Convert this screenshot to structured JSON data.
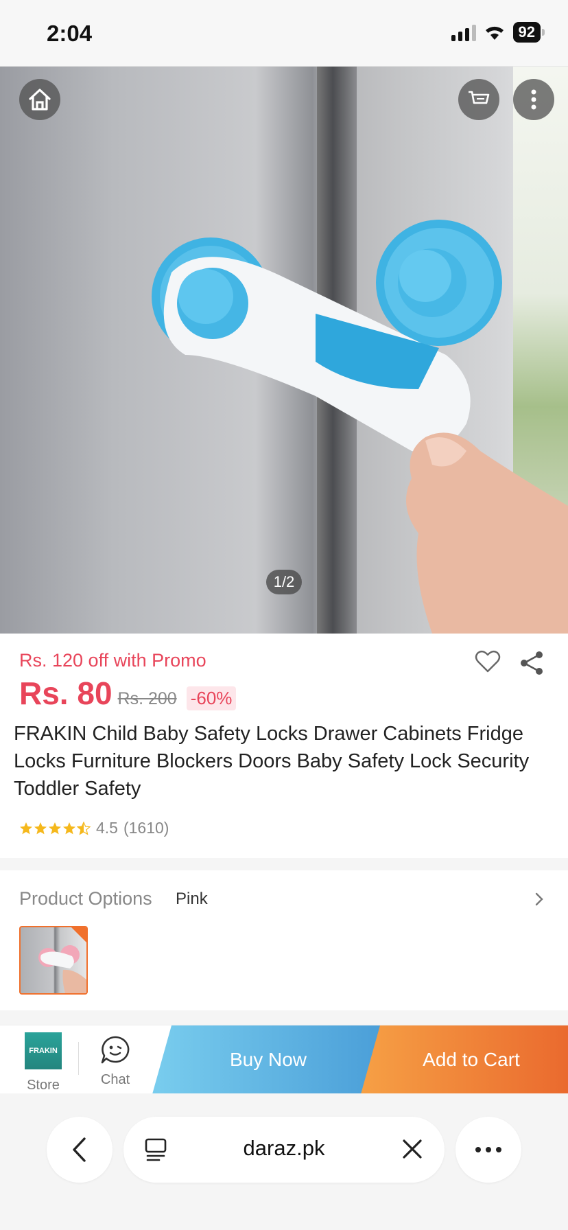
{
  "status_bar": {
    "time": "2:04",
    "battery": "92"
  },
  "hero": {
    "page_indicator": "1/2"
  },
  "product": {
    "promo": "Rs. 120 off with Promo",
    "price": "Rs. 80",
    "original_price": "Rs. 200",
    "discount": "-60%",
    "title": "FRAKIN Child Baby Safety Locks Drawer Cabinets Fridge Locks Furniture Blockers Doors Baby Safety Lock Security Toddler Safety",
    "rating": "4.5",
    "rating_value": 4.5,
    "review_count": "(1610)"
  },
  "options": {
    "label": "Product Options",
    "selected": "Pink"
  },
  "action_bar": {
    "store_logo_text": "FRAKIN",
    "store_label": "Store",
    "chat_label": "Chat",
    "buy_now": "Buy Now",
    "add_to_cart": "Add to Cart"
  },
  "browser": {
    "url": "daraz.pk"
  },
  "colors": {
    "price_red": "#e8455a",
    "buy_now": "#4a9ed8",
    "add_to_cart": "#ea6a2e",
    "selected_border": "#f0702c",
    "star": "#f5b81c"
  },
  "icons": [
    "home-icon",
    "cart-icon",
    "more-vertical-icon",
    "heart-icon",
    "share-icon",
    "star-icon",
    "chevron-right-icon",
    "chat-icon",
    "back-icon",
    "tabs-icon",
    "close-icon",
    "more-horizontal-icon"
  ]
}
